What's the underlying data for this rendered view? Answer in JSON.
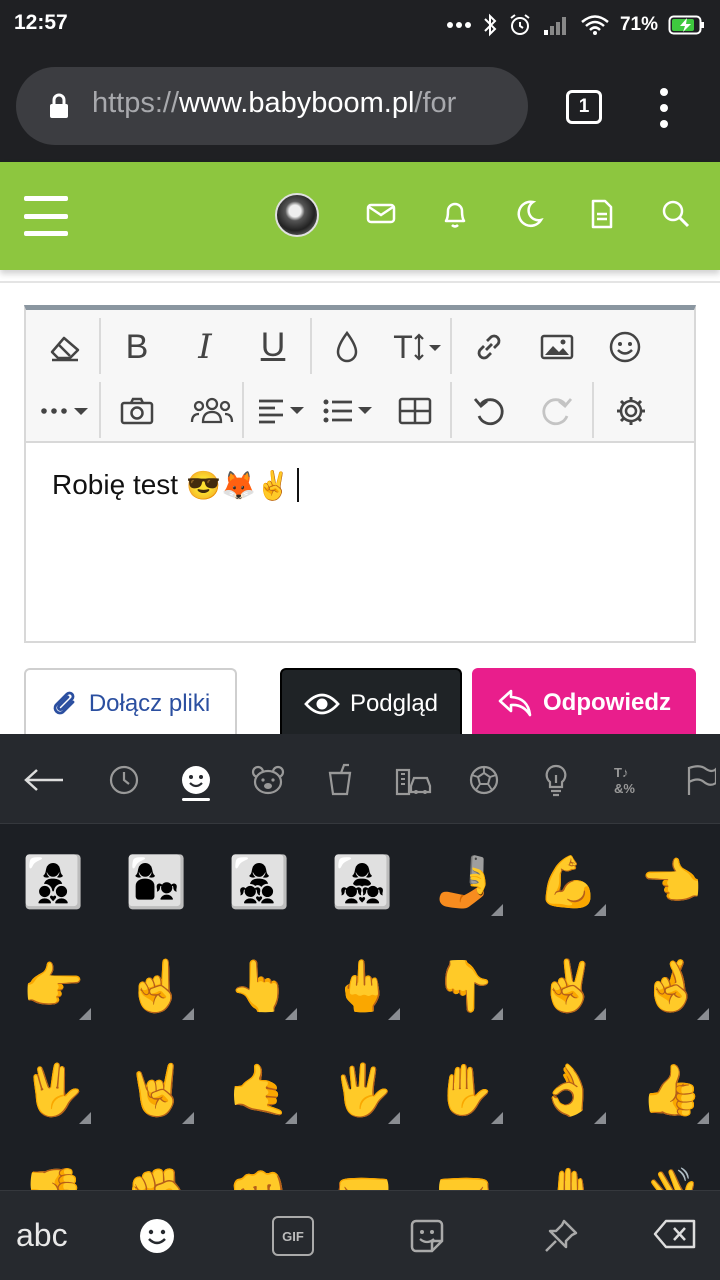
{
  "status_bar": {
    "time": "12:57",
    "battery": "71%"
  },
  "browser": {
    "url_prefix": "https://",
    "url_host": "www.babyboom.pl",
    "url_path": "/for",
    "tab_count": "1"
  },
  "site_header": {
    "icons": [
      "menu-icon",
      "avatar",
      "mail-icon",
      "bell-icon",
      "moon-icon",
      "document-icon",
      "search-icon"
    ],
    "accent": "#8dc63f"
  },
  "editor": {
    "content_text": "Robię test",
    "content_emojis": "😎🦊✌️",
    "toolbar_row1": [
      "eraser-icon",
      "bold",
      "italic",
      "underline",
      "color-drop-icon",
      "font-size-icon",
      "link-icon",
      "image-icon",
      "smiley-icon"
    ],
    "toolbar_row2": [
      "more-icon",
      "camera-icon",
      "users-icon",
      "align-icon",
      "list-icon",
      "table-icon",
      "undo-icon",
      "redo-icon",
      "settings-icon"
    ],
    "bold_label": "B",
    "italic_label": "I",
    "underline_label": "U",
    "font_size_label": "T"
  },
  "actions": {
    "attach_label": "Dołącz pliki",
    "preview_label": "Podgląd",
    "reply_label": "Odpowiedz",
    "reply_color": "#e91e8c"
  },
  "keyboard": {
    "categories": [
      "back-arrow-icon",
      "recent-icon",
      "smileys-icon",
      "animals-icon",
      "food-icon",
      "travel-icon",
      "activity-icon",
      "objects-icon",
      "symbols-icon",
      "flags-icon"
    ],
    "selected_category": "smileys-icon",
    "emojis": [
      [
        "👩‍👦‍👦",
        "👩‍👧",
        "👩‍👧‍👦",
        "👩‍👧‍👧",
        "🤳",
        "💪",
        "👈"
      ],
      [
        "👉",
        "☝️",
        "👆",
        "🖕",
        "👇",
        "✌️",
        "🤞"
      ],
      [
        "🖖",
        "🤘",
        "🤙",
        "🖐️",
        "✋",
        "👌",
        "👍"
      ],
      [
        "👎",
        "✊",
        "👊",
        "🤛",
        "🤜",
        "🤚",
        "👋"
      ]
    ],
    "abc_label": "abc",
    "gif_label": "GIF"
  }
}
